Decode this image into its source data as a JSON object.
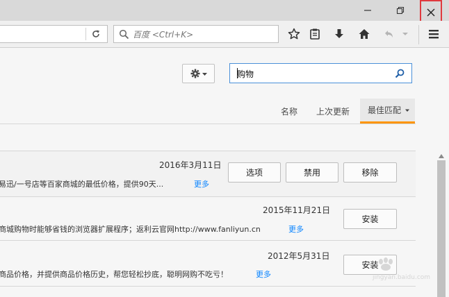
{
  "window": {
    "minimize_icon": "minimize-icon",
    "restore_icon": "restore-icon",
    "close_icon": "close-icon",
    "highlight_color": "#e0393e"
  },
  "toolbar": {
    "search_placeholder": "百度 <Ctrl+K>",
    "icons": [
      "reload-icon",
      "search-icon",
      "bookmark-star-icon",
      "reading-list-icon",
      "download-icon",
      "home-icon",
      "undo-icon",
      "chevron-down-icon",
      "menu-icon"
    ]
  },
  "addons": {
    "search_value": "购物",
    "sort": {
      "name": "名称",
      "last_updated": "上次更新",
      "best_match": "最佳匹配",
      "accent_color": "#ff9400"
    },
    "items": [
      {
        "date": "2016年3月11日",
        "description": "易迅/一号店等百家商城的最低价格，提供90天...",
        "more": "更多",
        "buttons": [
          "选项",
          "禁用",
          "移除"
        ]
      },
      {
        "date": "2015年11月21日",
        "description": "商城购物时能够省钱的浏览器扩展程序；返利云官网http://www.fanliyun.cn",
        "more": "更多",
        "buttons": [
          "安装"
        ]
      },
      {
        "date": "2012年5月31日",
        "description": "商品价格，并提供商品价格历史，帮您轻松抄底，聪明网购不吃亏！",
        "more": "更多",
        "buttons": [
          "安装"
        ]
      }
    ]
  },
  "watermark": "jingyan.baidu.com"
}
